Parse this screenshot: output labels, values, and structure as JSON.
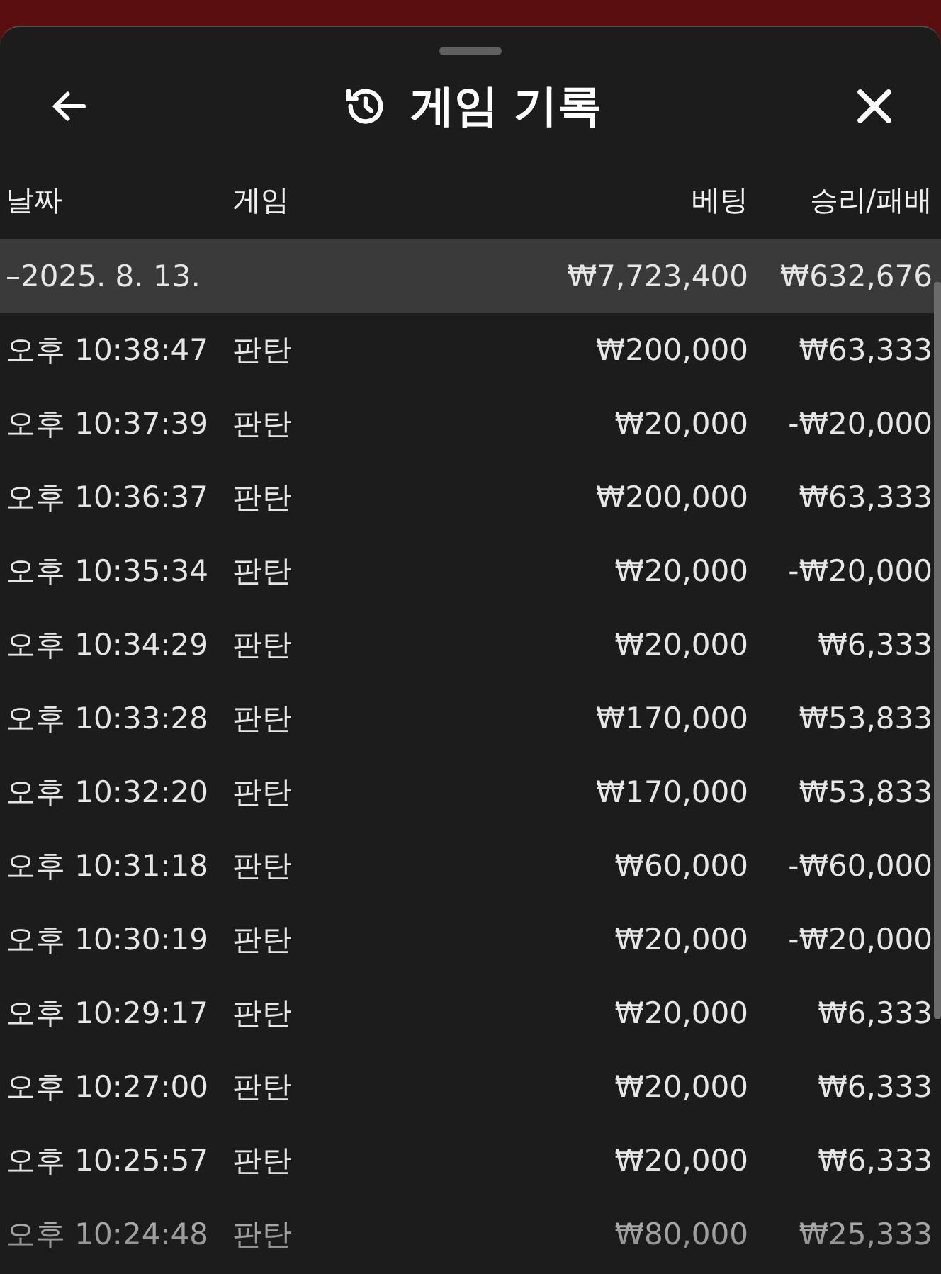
{
  "header": {
    "title": "게임 기록"
  },
  "table": {
    "columns": [
      "날짜",
      "게임",
      "베팅",
      "승리/패배"
    ],
    "summary": {
      "date": "–2025. 8. 13.",
      "bet": "₩7,723,400",
      "result": "₩632,676"
    },
    "rows": [
      {
        "time": "오후 10:38:47",
        "game": "판탄",
        "bet": "₩200,000",
        "result": "₩63,333"
      },
      {
        "time": "오후 10:37:39",
        "game": "판탄",
        "bet": "₩20,000",
        "result": "-₩20,000"
      },
      {
        "time": "오후 10:36:37",
        "game": "판탄",
        "bet": "₩200,000",
        "result": "₩63,333"
      },
      {
        "time": "오후 10:35:34",
        "game": "판탄",
        "bet": "₩20,000",
        "result": "-₩20,000"
      },
      {
        "time": "오후 10:34:29",
        "game": "판탄",
        "bet": "₩20,000",
        "result": "₩6,333"
      },
      {
        "time": "오후 10:33:28",
        "game": "판탄",
        "bet": "₩170,000",
        "result": "₩53,833"
      },
      {
        "time": "오후 10:32:20",
        "game": "판탄",
        "bet": "₩170,000",
        "result": "₩53,833"
      },
      {
        "time": "오후 10:31:18",
        "game": "판탄",
        "bet": "₩60,000",
        "result": "-₩60,000"
      },
      {
        "time": "오후 10:30:19",
        "game": "판탄",
        "bet": "₩20,000",
        "result": "-₩20,000"
      },
      {
        "time": "오후 10:29:17",
        "game": "판탄",
        "bet": "₩20,000",
        "result": "₩6,333"
      },
      {
        "time": "오후 10:27:00",
        "game": "판탄",
        "bet": "₩20,000",
        "result": "₩6,333"
      },
      {
        "time": "오후 10:25:57",
        "game": "판탄",
        "bet": "₩20,000",
        "result": "₩6,333"
      },
      {
        "time": "오후 10:24:48",
        "game": "판탄",
        "bet": "₩80,000",
        "result": "₩25,333"
      }
    ]
  }
}
